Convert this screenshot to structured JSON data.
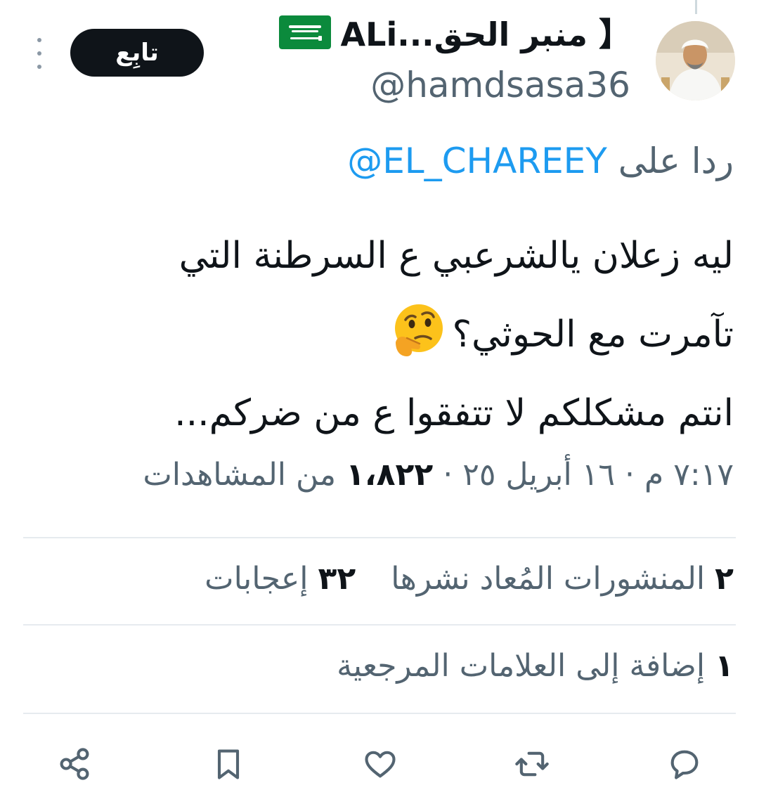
{
  "author": {
    "display_name": "ALi...منبر الحق 】",
    "handle": "@hamdsasa36",
    "flag_icon": "saudi-arabia-flag-icon"
  },
  "follow_label": "تابِع",
  "reply": {
    "prefix": "ردا على",
    "mention": "@EL_CHAREEY"
  },
  "tweet": {
    "line1": "ليه زعلان يالشرعبي ع السرطنة التي",
    "line2": "تآمرت مع الحوثي؟",
    "line2_emoji": "thinking-face-emoji",
    "line3": "انتم مشكلكم لا تتفقوا ع من ضركم..."
  },
  "meta": {
    "time": "٧:١٧ م",
    "sep": "·",
    "date": "١٦ أبريل ٢٥",
    "views_count": "١،٨٢٢",
    "views_label": "من المشاهدات"
  },
  "stats": {
    "reposts_count": "٢",
    "reposts_label": "المنشورات المُعاد نشرها",
    "likes_count": "٣٢",
    "likes_label": "إعجابات",
    "bookmarks_count": "١",
    "bookmarks_label": "إضافة إلى العلامات المرجعية"
  },
  "actions": [
    "reply-icon",
    "retweet-icon",
    "like-icon",
    "bookmark-icon",
    "share-icon"
  ],
  "colors": {
    "text": "#0f1419",
    "secondary": "#536471",
    "link": "#1d9bf0",
    "follow_bg": "#0f1419",
    "divider": "#e6ebef"
  }
}
